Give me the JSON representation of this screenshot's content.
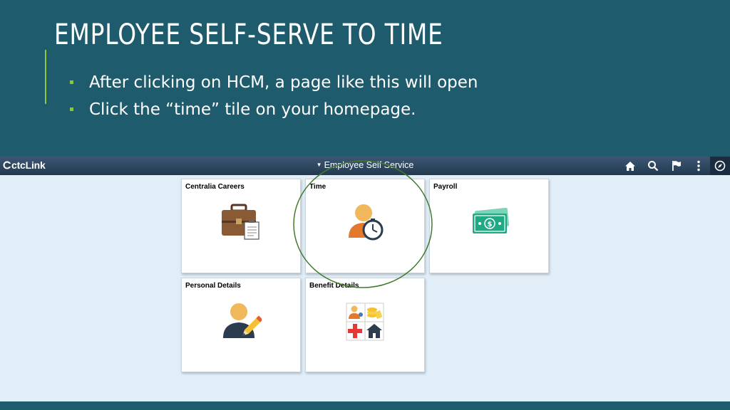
{
  "slide": {
    "title": "EMPLOYEE SELF-SERVE TO TIME",
    "bullets": [
      "After clicking on HCM, a page like this will open",
      "Click the “time” tile on your homepage."
    ],
    "colors": {
      "background": "#1e5b6c",
      "accent": "#8cc63e",
      "highlight": "#3f7a2c"
    }
  },
  "app": {
    "brand": "ctcLink",
    "nav_title": "Employee Self Service",
    "toolbar_icons": [
      "home-icon",
      "search-icon",
      "flag-icon",
      "kebab-menu-icon",
      "navbar-compass-icon"
    ],
    "tiles": [
      {
        "label": "Centralia Careers",
        "icon": "briefcase-icon"
      },
      {
        "label": "Time",
        "icon": "person-clock-icon"
      },
      {
        "label": "Payroll",
        "icon": "money-icon"
      },
      {
        "label": "Personal Details",
        "icon": "person-pencil-icon"
      },
      {
        "label": "Benefit Details",
        "icon": "benefits-grid-icon"
      }
    ]
  }
}
